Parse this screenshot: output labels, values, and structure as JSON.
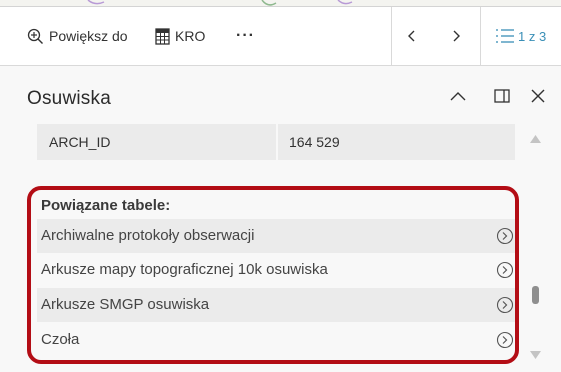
{
  "toolbar": {
    "zoom_label": "Powiększ do",
    "kro_label": "KRO",
    "more_label": "···",
    "counter": "1 z 3"
  },
  "header": {
    "title": "Osuwiska"
  },
  "attribute": {
    "key": "ARCH_ID",
    "value": "164 529"
  },
  "related": {
    "title": "Powiązane tabele:",
    "items": [
      {
        "label": "Archiwalne protokoły obserwacji"
      },
      {
        "label": "Arkusze mapy topograficznej 10k osuwiska"
      },
      {
        "label": "Arkusze SMGP osuwiska"
      },
      {
        "label": "Czoła"
      }
    ]
  },
  "colors": {
    "highlight": "#b30d15",
    "panel_bg": "#f8f8f8",
    "row_bg": "#ebebeb"
  }
}
